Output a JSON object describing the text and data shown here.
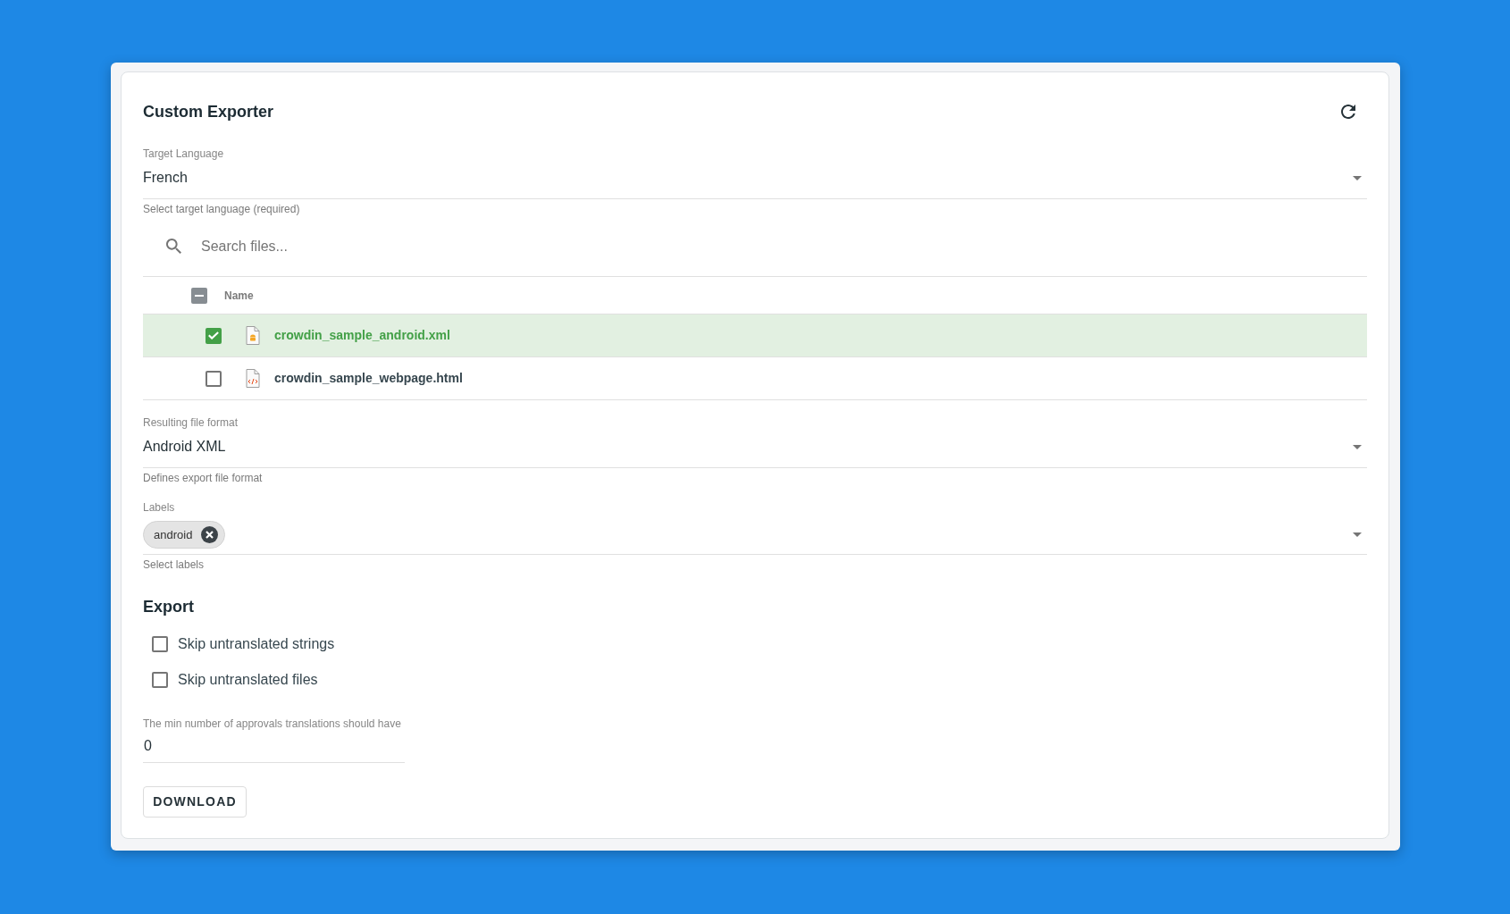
{
  "header": {
    "title": "Custom Exporter"
  },
  "target_language": {
    "label": "Target Language",
    "value": "French",
    "helper": "Select target language (required)"
  },
  "file_search": {
    "placeholder": "Search files..."
  },
  "file_table": {
    "columns": [
      "Name"
    ],
    "select_all": {
      "indeterminate": true
    },
    "rows": [
      {
        "name": "crowdin_sample_android.xml",
        "kind": "android",
        "selected": true,
        "checked": true
      },
      {
        "name": "crowdin_sample_webpage.html",
        "kind": "html",
        "selected": false,
        "checked": false
      }
    ]
  },
  "file_format": {
    "label": "Resulting file format",
    "value": "Android XML",
    "helper": "Defines export file format"
  },
  "labels_field": {
    "label": "Labels",
    "chips": [
      "android"
    ],
    "helper": "Select labels"
  },
  "export": {
    "heading": "Export",
    "options": [
      {
        "label": "Skip untranslated strings",
        "checked": false
      },
      {
        "label": "Skip untranslated files",
        "checked": false
      }
    ]
  },
  "min_approvals": {
    "label": "The min number of approvals translations should have",
    "value": "0"
  },
  "download_button": {
    "label": "DOWNLOAD"
  }
}
